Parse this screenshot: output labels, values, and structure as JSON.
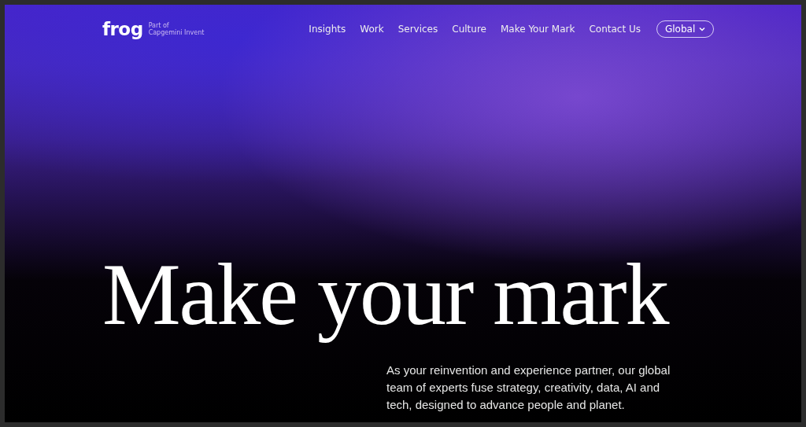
{
  "logo": {
    "wordmark": "frog",
    "tagline_line_1": "Part of",
    "tagline_line_2": "Capgemini Invent"
  },
  "nav": {
    "items": [
      {
        "label": "Insights"
      },
      {
        "label": "Work"
      },
      {
        "label": "Services"
      },
      {
        "label": "Culture"
      },
      {
        "label": "Make Your Mark"
      },
      {
        "label": "Contact Us"
      }
    ],
    "region_button": {
      "label": "Global"
    }
  },
  "hero": {
    "headline": "Make your mark",
    "description": "As your reinvention and experience partner, our global team of experts fuse strategy, creativity, data, AI and tech, designed to advance people and planet."
  }
}
